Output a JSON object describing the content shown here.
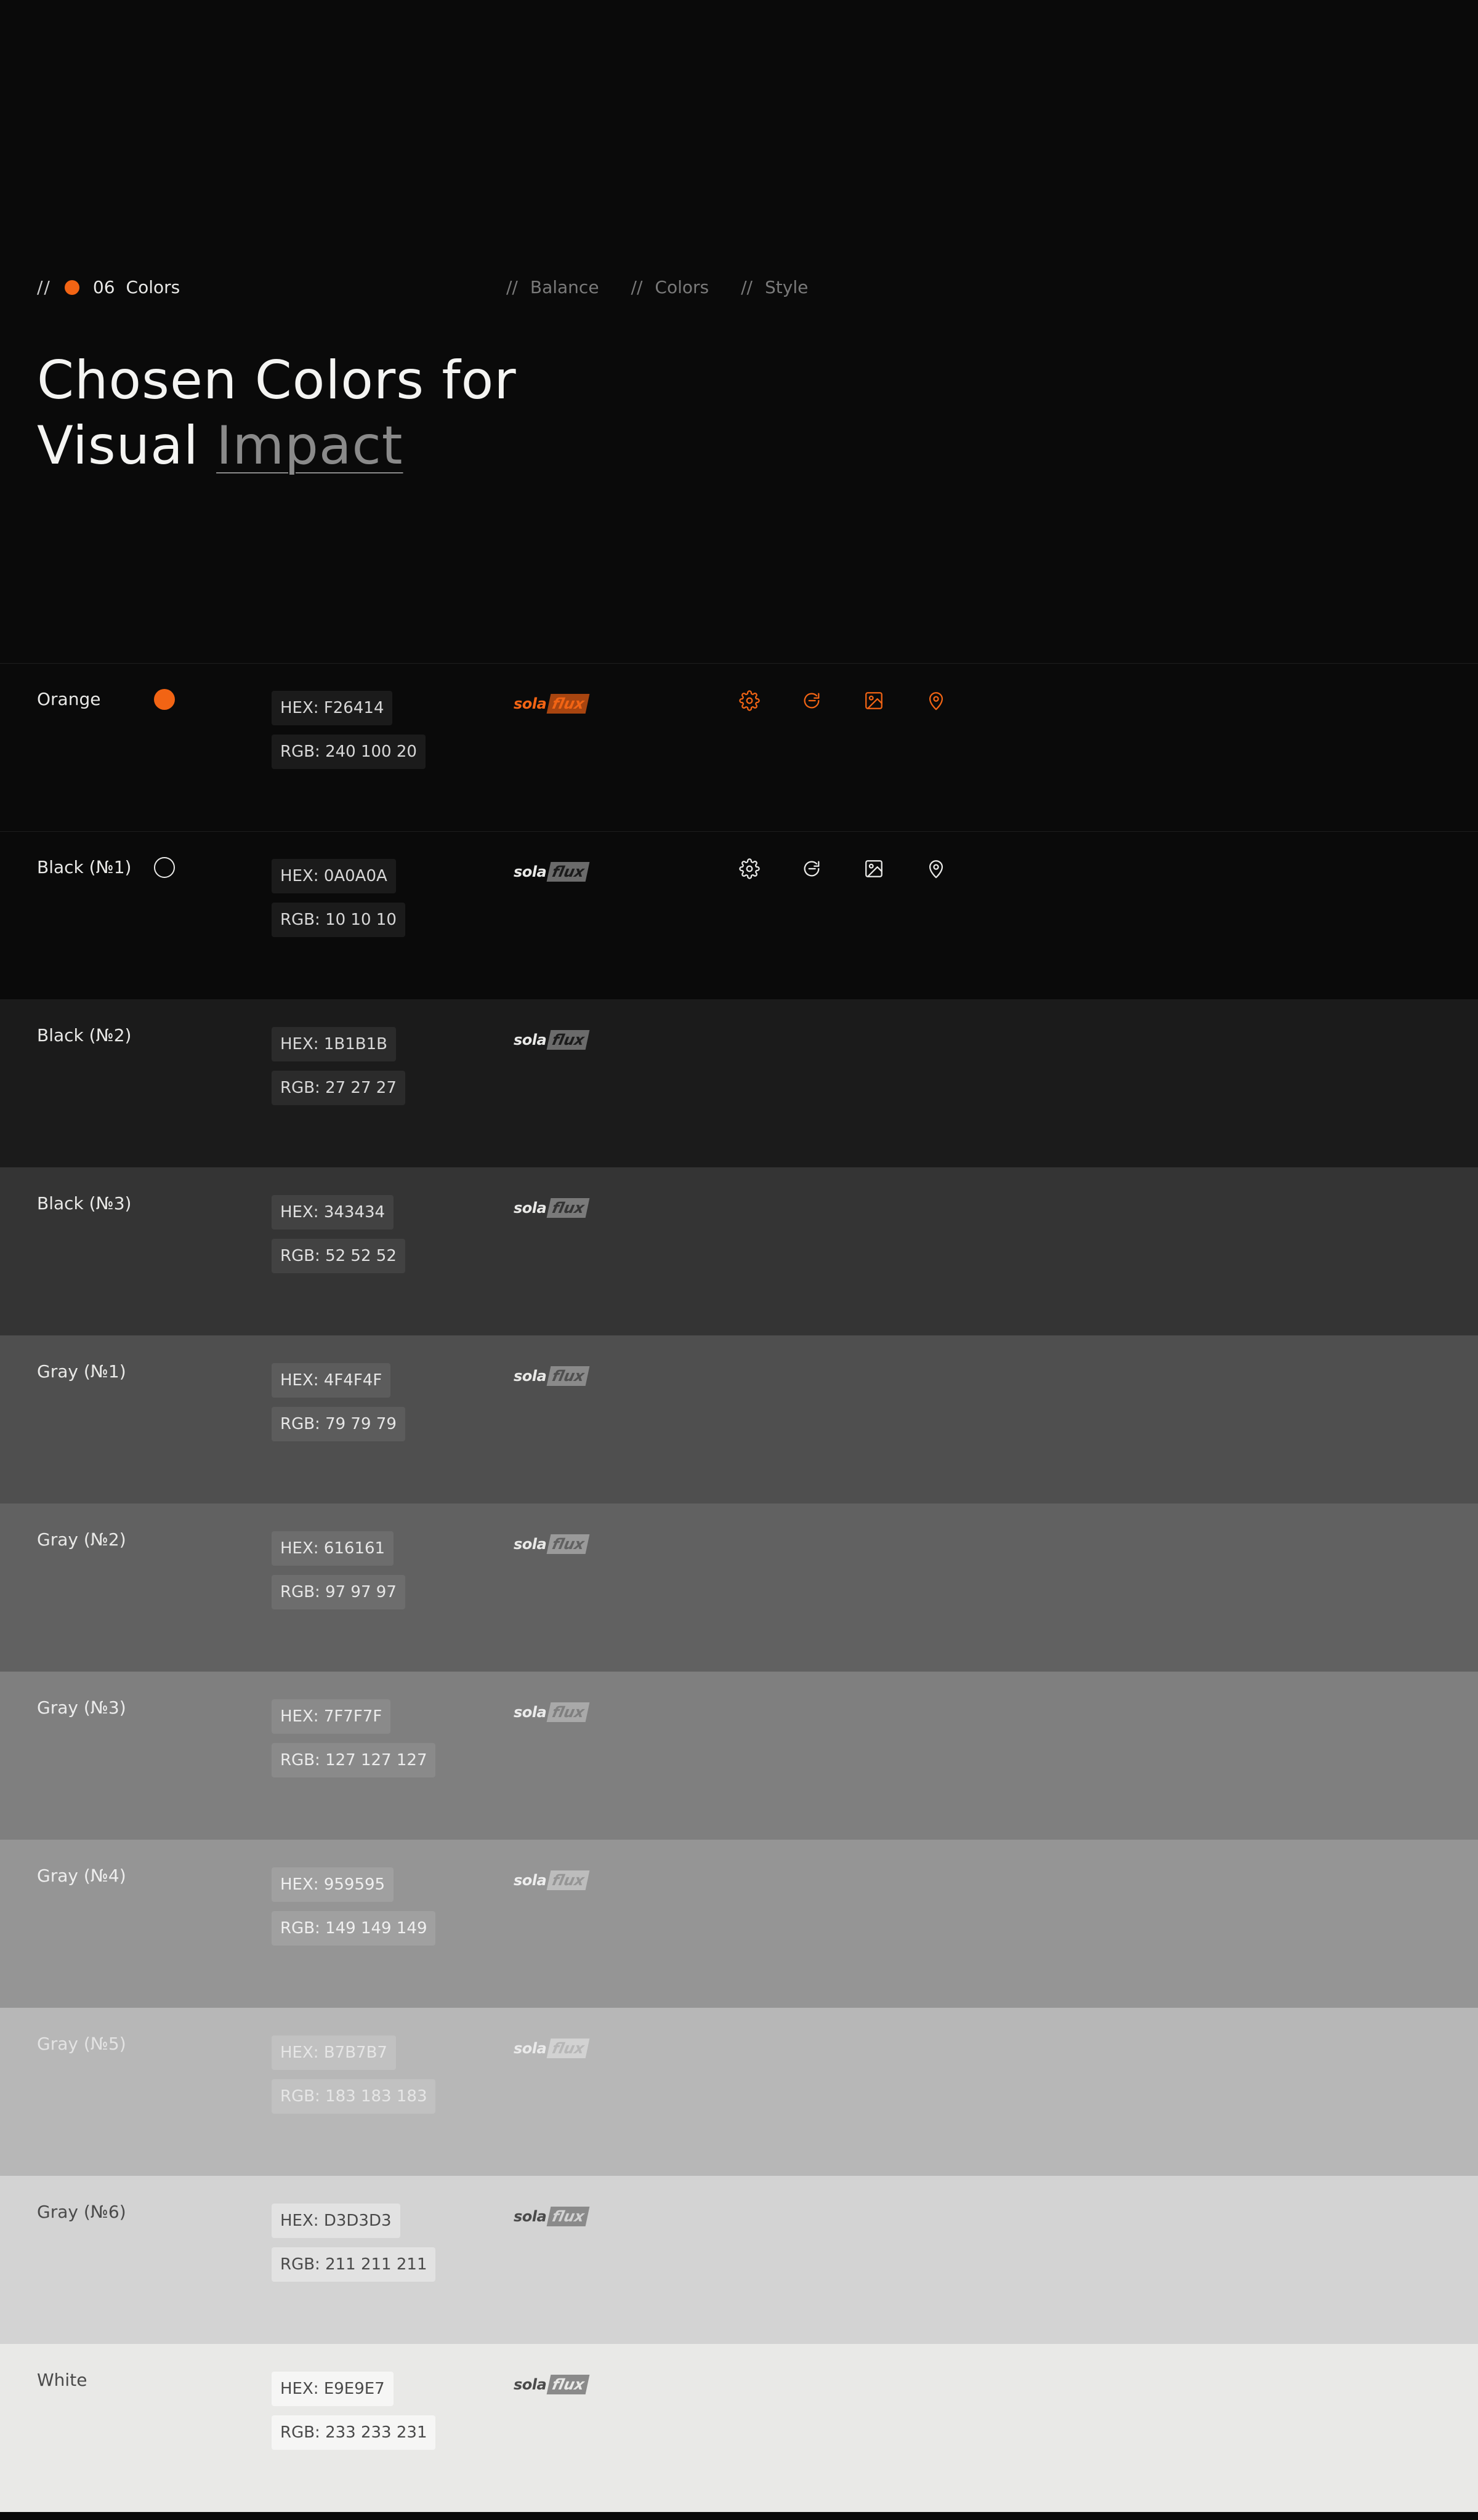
{
  "header": {
    "breadcrumb_slashes": "//",
    "section_number": "06",
    "section_title": "Colors",
    "tags": [
      {
        "slashes": "//",
        "label": "Balance"
      },
      {
        "slashes": "//",
        "label": "Colors"
      },
      {
        "slashes": "//",
        "label": "Style"
      }
    ],
    "title_line1": "Chosen Colors for",
    "title_line2_plain": "Visual",
    "title_line2_accent": "Impact"
  },
  "brand": {
    "logo_part1": "sola",
    "logo_part2": "flux",
    "accent_color": "#f26414"
  },
  "icons": [
    "gear-icon",
    "refresh-icon",
    "image-icon",
    "location-pin-icon"
  ],
  "colors": [
    {
      "name": "Orange",
      "hex": "HEX: F26414",
      "rgb": "RGB: 240 100 20",
      "bg": "#0a0a0a",
      "fg": "#e9e9e7",
      "pill_bg": "#1b1b1b",
      "pill_fg": "#d8d8d8",
      "logo_sola": "#f26414",
      "logo_flux_bg": "#a84510",
      "logo_flux_fg": "#f26414",
      "icon_color": "#f26414"
    },
    {
      "name": "Black (№1)",
      "hex": "HEX: 0A0A0A",
      "rgb": "RGB: 10 10 10",
      "bg": "#0a0a0a",
      "fg": "#e9e9e7",
      "pill_bg": "#1b1b1b",
      "pill_fg": "#d8d8d8",
      "logo_sola": "#e9e9e7",
      "logo_flux_bg": "#6b6b6b",
      "logo_flux_fg": "#1b1b1b",
      "icon_color": "#e9e9e7"
    },
    {
      "name": "Black (№2)",
      "hex": "HEX: 1B1B1B",
      "rgb": "RGB: 27 27 27",
      "bg": "#1b1b1b",
      "fg": "#e9e9e7",
      "pill_bg": "#2b2b2b",
      "pill_fg": "#d8d8d8",
      "logo_sola": "#e9e9e7",
      "logo_flux_bg": "#6b6b6b",
      "logo_flux_fg": "#1b1b1b"
    },
    {
      "name": "Black (№3)",
      "hex": "HEX: 343434",
      "rgb": "RGB: 52 52 52",
      "bg": "#343434",
      "fg": "#e9e9e7",
      "pill_bg": "#424242",
      "pill_fg": "#e0e0e0",
      "logo_sola": "#e9e9e7",
      "logo_flux_bg": "#7a7a7a",
      "logo_flux_fg": "#343434"
    },
    {
      "name": "Gray (№1)",
      "hex": "HEX: 4F4F4F",
      "rgb": "RGB: 79 79 79",
      "bg": "#4f4f4f",
      "fg": "#e9e9e7",
      "pill_bg": "#5c5c5c",
      "pill_fg": "#e6e6e6",
      "logo_sola": "#e9e9e7",
      "logo_flux_bg": "#8a8a8a",
      "logo_flux_fg": "#4f4f4f"
    },
    {
      "name": "Gray (№2)",
      "hex": "HEX: 616161",
      "rgb": "RGB: 97 97 97",
      "bg": "#616161",
      "fg": "#e9e9e7",
      "pill_bg": "#6d6d6d",
      "pill_fg": "#e6e6e6",
      "logo_sola": "#e9e9e7",
      "logo_flux_bg": "#9a9a9a",
      "logo_flux_fg": "#616161"
    },
    {
      "name": "Gray (№3)",
      "hex": "HEX: 7F7F7F",
      "rgb": "RGB: 127 127 127",
      "bg": "#7f7f7f",
      "fg": "#ececec",
      "pill_bg": "#8a8a8a",
      "pill_fg": "#ececec",
      "logo_sola": "#ececec",
      "logo_flux_bg": "#a9a9a9",
      "logo_flux_fg": "#7f7f7f"
    },
    {
      "name": "Gray (№4)",
      "hex": "HEX: 959595",
      "rgb": "RGB: 149 149 149",
      "bg": "#959595",
      "fg": "#eeeeee",
      "pill_bg": "#a0a0a0",
      "pill_fg": "#f0f0f0",
      "logo_sola": "#eeeeee",
      "logo_flux_bg": "#bdbdbd",
      "logo_flux_fg": "#959595"
    },
    {
      "name": "Gray (№5)",
      "hex": "HEX: B7B7B7",
      "rgb": "RGB: 183 183 183",
      "bg": "#b7b7b7",
      "fg": "#e3e3e3",
      "pill_bg": "#c1c1c1",
      "pill_fg": "#e6e6e6",
      "logo_sola": "#eaeaea",
      "logo_flux_bg": "#d2d2d2",
      "logo_flux_fg": "#b7b7b7"
    },
    {
      "name": "Gray (№6)",
      "hex": "HEX: D3D3D3",
      "rgb": "RGB: 211 211 211",
      "bg": "#d3d3d3",
      "fg": "#4a4a4a",
      "pill_bg": "#e2e2e2",
      "pill_fg": "#4a4a4a",
      "logo_sola": "#4a4a4a",
      "logo_flux_bg": "#8a8a8a",
      "logo_flux_fg": "#d3d3d3"
    },
    {
      "name": "White",
      "hex": "HEX: E9E9E7",
      "rgb": "RGB: 233 233 231",
      "bg": "#e9e9e7",
      "fg": "#4a4a4a",
      "pill_bg": "#f6f6f5",
      "pill_fg": "#4a4a4a",
      "logo_sola": "#4a4a4a",
      "logo_flux_bg": "#8a8a8a",
      "logo_flux_fg": "#e9e9e7"
    }
  ]
}
